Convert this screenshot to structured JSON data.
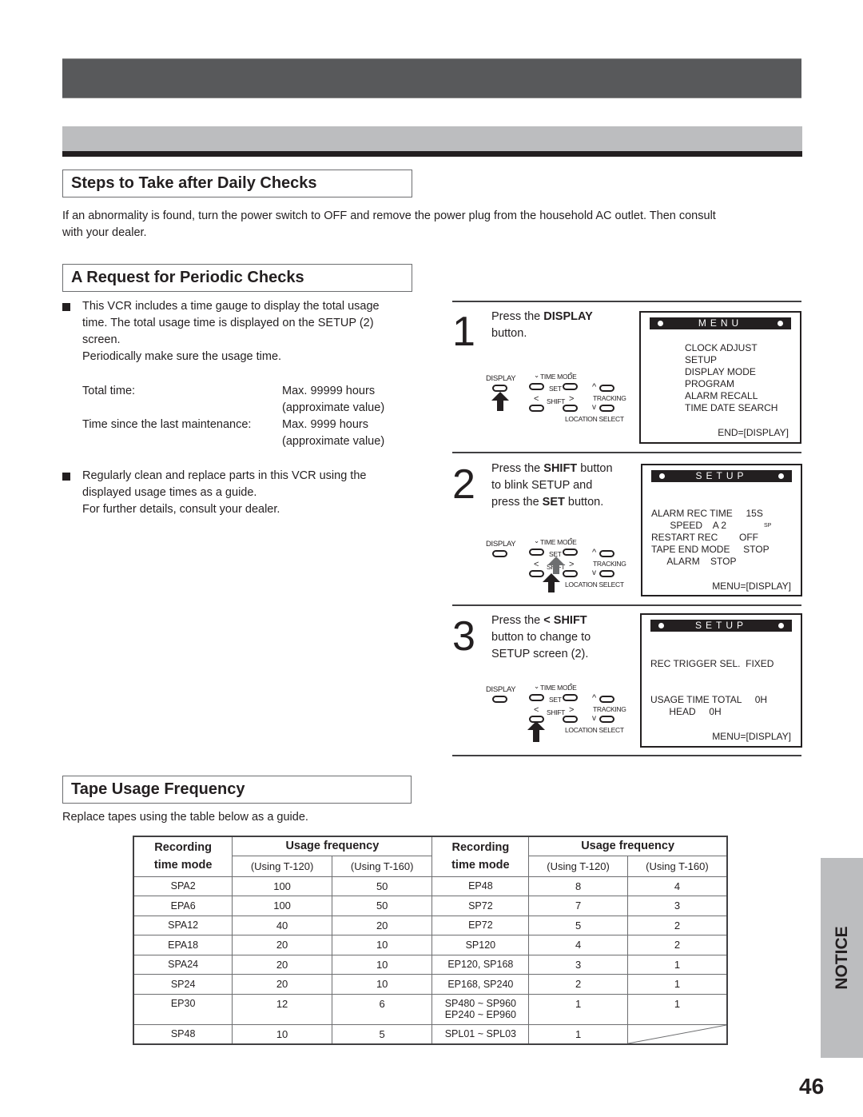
{
  "header_bars": {},
  "sections": {
    "daily": {
      "title": "Steps to Take after Daily Checks",
      "body_line1": "If an abnormality is found, turn the power switch to OFF and remove the power plug from the household AC outlet. Then consult",
      "body_line2": "with your dealer."
    },
    "periodic": {
      "title": "A Request for Periodic Checks",
      "bullet1": [
        "This VCR includes a time gauge to display the total usage",
        "time. The total usage time is displayed on the SETUP (2)",
        "screen.",
        "Periodically make sure the usage time."
      ],
      "specs": [
        {
          "label": "Total time:",
          "value": "Max. 99999 hours",
          "note": "(approximate value)"
        },
        {
          "label": "Time since the last maintenance:",
          "value": "Max. 9999 hours",
          "note": "(approximate value)"
        }
      ],
      "bullet2": [
        "Regularly clean and replace parts in this VCR using the",
        "displayed usage times as a guide.",
        "For further details, consult your dealer."
      ]
    },
    "tape": {
      "title": "Tape Usage Frequency",
      "intro": "Replace tapes using the table below as a guide."
    }
  },
  "steps": [
    {
      "num": "1",
      "lines": [
        {
          "pre": "Press the ",
          "bold": "DISPLAY",
          "post": ""
        },
        {
          "pre": "button.",
          "bold": "",
          "post": ""
        }
      ],
      "osd": {
        "title": "MENU",
        "lines": [
          "CLOCK ADJUST",
          "SETUP",
          "DISPLAY MODE",
          "PROGRAM",
          "ALARM RECALL",
          "TIME DATE SEARCH"
        ],
        "footer": "END=[DISPLAY]"
      }
    },
    {
      "num": "2",
      "lines": [
        {
          "pre": "Press the ",
          "bold": "SHIFT",
          "post": " button"
        },
        {
          "pre": "to blink SETUP and",
          "bold": "",
          "post": ""
        },
        {
          "pre": "press the ",
          "bold": "SET",
          "post": " button."
        }
      ],
      "osd": {
        "title": "SETUP",
        "lines": [
          "ALARM REC TIME     15S",
          "       SPEED    A 2",
          "RESTART REC        OFF",
          "TAPE END MODE     STOP",
          "      ALARM    STOP"
        ],
        "sp_mark": "SP",
        "footer": "MENU=[DISPLAY]"
      }
    },
    {
      "num": "3",
      "lines": [
        {
          "pre": "Press the ",
          "bold": "< SHIFT",
          "post": ""
        },
        {
          "pre": "button to change to",
          "bold": "",
          "post": ""
        },
        {
          "pre": "SETUP screen (2).",
          "bold": "",
          "post": ""
        }
      ],
      "osd": {
        "title": "SETUP",
        "lines": [
          "REC TRIGGER SEL.  FIXED",
          "USAGE TIME TOTAL     0H",
          "       HEAD     0H"
        ],
        "footer": "MENU=[DISPLAY]"
      }
    }
  ],
  "remote_labels": {
    "display": "DISPLAY",
    "time_mode": "TIME MODE",
    "set": "SET",
    "shift": "SHIFT",
    "tracking": "TRACKING",
    "location_select": "LOCATION SELECT"
  },
  "table": {
    "header_mode": [
      "Recording",
      "time mode"
    ],
    "header_freq": "Usage frequency",
    "sub_t120": "(Using T-120)",
    "sub_t160": "(Using T-160)",
    "left_rows": [
      {
        "mode": "SPA2",
        "t120": "100",
        "t160": "50"
      },
      {
        "mode": "EPA6",
        "t120": "100",
        "t160": "50"
      },
      {
        "mode": "SPA12",
        "t120": "40",
        "t160": "20"
      },
      {
        "mode": "EPA18",
        "t120": "20",
        "t160": "10"
      },
      {
        "mode": "SPA24",
        "t120": "20",
        "t160": "10"
      },
      {
        "mode": "SP24",
        "t120": "20",
        "t160": "10"
      },
      {
        "mode": "EP30",
        "t120": "12",
        "t160": "6"
      },
      {
        "mode": "SP48",
        "t120": "10",
        "t160": "5"
      }
    ],
    "right_rows": [
      {
        "mode": "EP48",
        "mode2": "",
        "t120": "8",
        "t160": "4"
      },
      {
        "mode": "SP72",
        "mode2": "",
        "t120": "7",
        "t160": "3"
      },
      {
        "mode": "EP72",
        "mode2": "",
        "t120": "5",
        "t160": "2"
      },
      {
        "mode": "SP120",
        "mode2": "",
        "t120": "4",
        "t160": "2"
      },
      {
        "mode": "EP120, SP168",
        "mode2": "",
        "t120": "3",
        "t160": "1"
      },
      {
        "mode": "EP168, SP240",
        "mode2": "",
        "t120": "2",
        "t160": "1"
      },
      {
        "mode": "SP480 ~ SP960",
        "mode2": "EP240 ~ EP960",
        "t120": "1",
        "t160": "1"
      },
      {
        "mode": "SPL01 ~ SPL03",
        "mode2": "",
        "t120": "1",
        "t160": ""
      }
    ]
  },
  "side_tab": "NOTICE",
  "page_number": "46"
}
